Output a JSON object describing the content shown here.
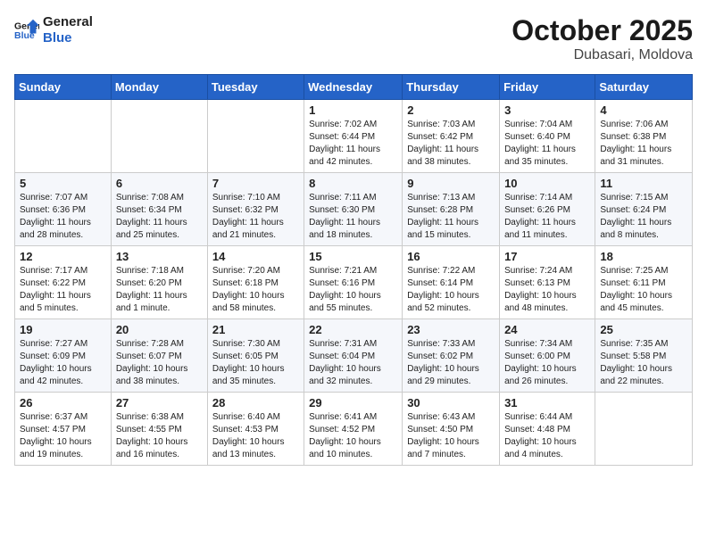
{
  "header": {
    "logo": "GeneralBlue",
    "month": "October 2025",
    "location": "Dubasari, Moldova"
  },
  "weekdays": [
    "Sunday",
    "Monday",
    "Tuesday",
    "Wednesday",
    "Thursday",
    "Friday",
    "Saturday"
  ],
  "weeks": [
    [
      {
        "day": "",
        "info": ""
      },
      {
        "day": "",
        "info": ""
      },
      {
        "day": "",
        "info": ""
      },
      {
        "day": "1",
        "info": "Sunrise: 7:02 AM\nSunset: 6:44 PM\nDaylight: 11 hours\nand 42 minutes."
      },
      {
        "day": "2",
        "info": "Sunrise: 7:03 AM\nSunset: 6:42 PM\nDaylight: 11 hours\nand 38 minutes."
      },
      {
        "day": "3",
        "info": "Sunrise: 7:04 AM\nSunset: 6:40 PM\nDaylight: 11 hours\nand 35 minutes."
      },
      {
        "day": "4",
        "info": "Sunrise: 7:06 AM\nSunset: 6:38 PM\nDaylight: 11 hours\nand 31 minutes."
      }
    ],
    [
      {
        "day": "5",
        "info": "Sunrise: 7:07 AM\nSunset: 6:36 PM\nDaylight: 11 hours\nand 28 minutes."
      },
      {
        "day": "6",
        "info": "Sunrise: 7:08 AM\nSunset: 6:34 PM\nDaylight: 11 hours\nand 25 minutes."
      },
      {
        "day": "7",
        "info": "Sunrise: 7:10 AM\nSunset: 6:32 PM\nDaylight: 11 hours\nand 21 minutes."
      },
      {
        "day": "8",
        "info": "Sunrise: 7:11 AM\nSunset: 6:30 PM\nDaylight: 11 hours\nand 18 minutes."
      },
      {
        "day": "9",
        "info": "Sunrise: 7:13 AM\nSunset: 6:28 PM\nDaylight: 11 hours\nand 15 minutes."
      },
      {
        "day": "10",
        "info": "Sunrise: 7:14 AM\nSunset: 6:26 PM\nDaylight: 11 hours\nand 11 minutes."
      },
      {
        "day": "11",
        "info": "Sunrise: 7:15 AM\nSunset: 6:24 PM\nDaylight: 11 hours\nand 8 minutes."
      }
    ],
    [
      {
        "day": "12",
        "info": "Sunrise: 7:17 AM\nSunset: 6:22 PM\nDaylight: 11 hours\nand 5 minutes."
      },
      {
        "day": "13",
        "info": "Sunrise: 7:18 AM\nSunset: 6:20 PM\nDaylight: 11 hours\nand 1 minute."
      },
      {
        "day": "14",
        "info": "Sunrise: 7:20 AM\nSunset: 6:18 PM\nDaylight: 10 hours\nand 58 minutes."
      },
      {
        "day": "15",
        "info": "Sunrise: 7:21 AM\nSunset: 6:16 PM\nDaylight: 10 hours\nand 55 minutes."
      },
      {
        "day": "16",
        "info": "Sunrise: 7:22 AM\nSunset: 6:14 PM\nDaylight: 10 hours\nand 52 minutes."
      },
      {
        "day": "17",
        "info": "Sunrise: 7:24 AM\nSunset: 6:13 PM\nDaylight: 10 hours\nand 48 minutes."
      },
      {
        "day": "18",
        "info": "Sunrise: 7:25 AM\nSunset: 6:11 PM\nDaylight: 10 hours\nand 45 minutes."
      }
    ],
    [
      {
        "day": "19",
        "info": "Sunrise: 7:27 AM\nSunset: 6:09 PM\nDaylight: 10 hours\nand 42 minutes."
      },
      {
        "day": "20",
        "info": "Sunrise: 7:28 AM\nSunset: 6:07 PM\nDaylight: 10 hours\nand 38 minutes."
      },
      {
        "day": "21",
        "info": "Sunrise: 7:30 AM\nSunset: 6:05 PM\nDaylight: 10 hours\nand 35 minutes."
      },
      {
        "day": "22",
        "info": "Sunrise: 7:31 AM\nSunset: 6:04 PM\nDaylight: 10 hours\nand 32 minutes."
      },
      {
        "day": "23",
        "info": "Sunrise: 7:33 AM\nSunset: 6:02 PM\nDaylight: 10 hours\nand 29 minutes."
      },
      {
        "day": "24",
        "info": "Sunrise: 7:34 AM\nSunset: 6:00 PM\nDaylight: 10 hours\nand 26 minutes."
      },
      {
        "day": "25",
        "info": "Sunrise: 7:35 AM\nSunset: 5:58 PM\nDaylight: 10 hours\nand 22 minutes."
      }
    ],
    [
      {
        "day": "26",
        "info": "Sunrise: 6:37 AM\nSunset: 4:57 PM\nDaylight: 10 hours\nand 19 minutes."
      },
      {
        "day": "27",
        "info": "Sunrise: 6:38 AM\nSunset: 4:55 PM\nDaylight: 10 hours\nand 16 minutes."
      },
      {
        "day": "28",
        "info": "Sunrise: 6:40 AM\nSunset: 4:53 PM\nDaylight: 10 hours\nand 13 minutes."
      },
      {
        "day": "29",
        "info": "Sunrise: 6:41 AM\nSunset: 4:52 PM\nDaylight: 10 hours\nand 10 minutes."
      },
      {
        "day": "30",
        "info": "Sunrise: 6:43 AM\nSunset: 4:50 PM\nDaylight: 10 hours\nand 7 minutes."
      },
      {
        "day": "31",
        "info": "Sunrise: 6:44 AM\nSunset: 4:48 PM\nDaylight: 10 hours\nand 4 minutes."
      },
      {
        "day": "",
        "info": ""
      }
    ]
  ]
}
